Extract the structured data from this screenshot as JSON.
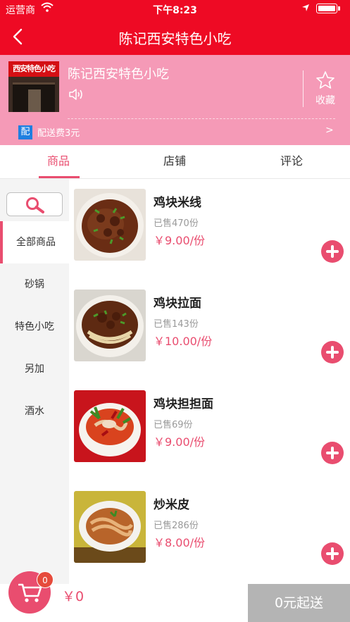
{
  "status_bar": {
    "carrier": "运营商",
    "time": "下午8:23"
  },
  "nav": {
    "title": "陈记西安特色小吃"
  },
  "shop": {
    "image_sign": "西安特色小吃",
    "name": "陈记西安特色小吃",
    "favorite_label": "收藏",
    "delivery_badge": "配",
    "delivery_text": "配送费3元",
    "delivery_arrow": ">"
  },
  "tabs": [
    {
      "label": "商品",
      "active": true
    },
    {
      "label": "店铺",
      "active": false
    },
    {
      "label": "评论",
      "active": false
    }
  ],
  "categories": [
    {
      "label": "全部商品",
      "active": true
    },
    {
      "label": "砂锅",
      "active": false
    },
    {
      "label": "特色小吃",
      "active": false
    },
    {
      "label": "另加",
      "active": false
    },
    {
      "label": "酒水",
      "active": false
    }
  ],
  "products": [
    {
      "name": "鸡块米线",
      "sold": "已售470份",
      "price": "￥9.00/份",
      "image_icon": "noodle-soup-with-greens"
    },
    {
      "name": "鸡块拉面",
      "sold": "已售143份",
      "price": "￥10.00/份",
      "image_icon": "noodle-soup-with-chicken"
    },
    {
      "name": "鸡块担担面",
      "sold": "已售69份",
      "price": "￥9.00/份",
      "image_icon": "spicy-noodle-bowl"
    },
    {
      "name": "炒米皮",
      "sold": "已售286份",
      "price": "￥8.00/份",
      "image_icon": "fried-rice-noodles"
    }
  ],
  "cart": {
    "count": "0",
    "total": "￥0",
    "checkout_label": "0元起送"
  },
  "colors": {
    "primary_red": "#ee0a24",
    "accent_pink": "#e94d6f",
    "header_pink": "#f59ab7",
    "checkout_gray": "#b4b4b4"
  }
}
